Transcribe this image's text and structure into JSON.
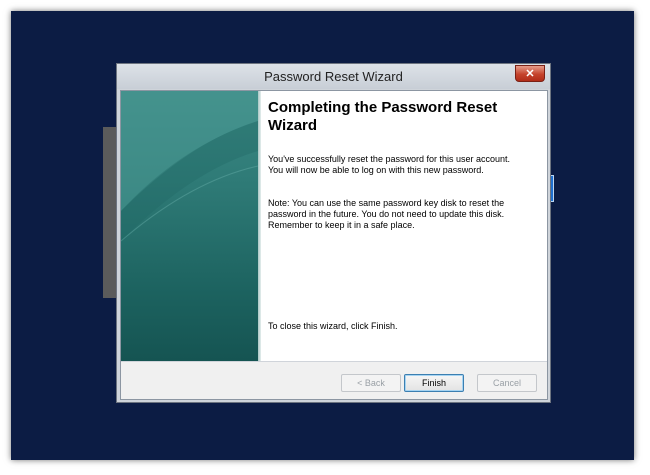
{
  "window": {
    "title": "Password Reset Wizard",
    "close_label": "✕"
  },
  "page": {
    "heading": "Completing the Password Reset Wizard",
    "paragraph1": "You've successfully reset the password for this user account. You will now be able to log on with this new password.",
    "paragraph2": "Note: You can use the same password key disk to reset the password in the future. You do not need to update this disk. Remember to keep it in a safe place.",
    "closing_text": "To close this wizard, click Finish."
  },
  "buttons": {
    "back": "< Back",
    "finish": "Finish",
    "cancel": "Cancel"
  },
  "colors": {
    "desktop_background": "#0c1c44",
    "banner_teal": "#2e7a76",
    "close_button_red": "#c5432c"
  },
  "icons": {
    "close": "close-icon"
  }
}
